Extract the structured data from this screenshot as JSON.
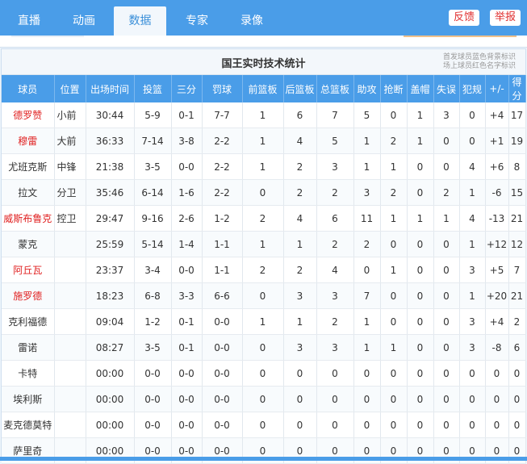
{
  "tabs": [
    {
      "label": "直播"
    },
    {
      "label": "动画"
    },
    {
      "label": "数据"
    },
    {
      "label": "专家"
    },
    {
      "label": "录像"
    }
  ],
  "buttons": {
    "feedback": "反馈",
    "report": "举报"
  },
  "panel": {
    "title": "国王实时技术统计",
    "note_line1": "首发球员蓝色背景标识",
    "note_line2": "场上球员红色名字标识"
  },
  "columns": [
    "球员",
    "位置",
    "出场时间",
    "投篮",
    "三分",
    "罚球",
    "前篮板",
    "后篮板",
    "总篮板",
    "助攻",
    "抢断",
    "盖帽",
    "失误",
    "犯规",
    "+/-",
    "得分"
  ],
  "colors": {
    "accent": "#4a9de8",
    "oncourt_name": "#e02020"
  },
  "rows": [
    {
      "name": "德罗赞",
      "pos": "小前",
      "min": "30:44",
      "fg": "5-9",
      "tp": "0-1",
      "ft": "7-7",
      "oreb": "1",
      "dreb": "6",
      "reb": "7",
      "ast": "5",
      "stl": "0",
      "blk": "1",
      "tov": "3",
      "pf": "0",
      "pm": "+4",
      "pts": "17",
      "oncourt": true
    },
    {
      "name": "穆雷",
      "pos": "大前",
      "min": "36:33",
      "fg": "7-14",
      "tp": "3-8",
      "ft": "2-2",
      "oreb": "1",
      "dreb": "4",
      "reb": "5",
      "ast": "1",
      "stl": "2",
      "blk": "1",
      "tov": "0",
      "pf": "0",
      "pm": "+1",
      "pts": "19",
      "oncourt": true
    },
    {
      "name": "尤班克斯",
      "pos": "中锋",
      "min": "21:38",
      "fg": "3-5",
      "tp": "0-0",
      "ft": "2-2",
      "oreb": "1",
      "dreb": "2",
      "reb": "3",
      "ast": "1",
      "stl": "1",
      "blk": "0",
      "tov": "0",
      "pf": "4",
      "pm": "+6",
      "pts": "8",
      "oncourt": false
    },
    {
      "name": "拉文",
      "pos": "分卫",
      "min": "35:46",
      "fg": "6-14",
      "tp": "1-6",
      "ft": "2-2",
      "oreb": "0",
      "dreb": "2",
      "reb": "2",
      "ast": "3",
      "stl": "2",
      "blk": "0",
      "tov": "2",
      "pf": "1",
      "pm": "-6",
      "pts": "15",
      "oncourt": false
    },
    {
      "name": "威斯布鲁克",
      "pos": "控卫",
      "min": "29:47",
      "fg": "9-16",
      "tp": "2-6",
      "ft": "1-2",
      "oreb": "2",
      "dreb": "4",
      "reb": "6",
      "ast": "11",
      "stl": "1",
      "blk": "1",
      "tov": "1",
      "pf": "4",
      "pm": "-13",
      "pts": "21",
      "oncourt": true
    },
    {
      "name": "蒙克",
      "pos": "",
      "min": "25:59",
      "fg": "5-14",
      "tp": "1-4",
      "ft": "1-1",
      "oreb": "1",
      "dreb": "1",
      "reb": "2",
      "ast": "2",
      "stl": "0",
      "blk": "0",
      "tov": "0",
      "pf": "1",
      "pm": "+12",
      "pts": "12",
      "oncourt": false
    },
    {
      "name": "阿丘瓦",
      "pos": "",
      "min": "23:37",
      "fg": "3-4",
      "tp": "0-0",
      "ft": "1-1",
      "oreb": "2",
      "dreb": "2",
      "reb": "4",
      "ast": "0",
      "stl": "1",
      "blk": "0",
      "tov": "0",
      "pf": "3",
      "pm": "+5",
      "pts": "7",
      "oncourt": true
    },
    {
      "name": "施罗德",
      "pos": "",
      "min": "18:23",
      "fg": "6-8",
      "tp": "3-3",
      "ft": "6-6",
      "oreb": "0",
      "dreb": "3",
      "reb": "3",
      "ast": "7",
      "stl": "0",
      "blk": "0",
      "tov": "0",
      "pf": "1",
      "pm": "+20",
      "pts": "21",
      "oncourt": true
    },
    {
      "name": "克利福德",
      "pos": "",
      "min": "09:04",
      "fg": "1-2",
      "tp": "0-1",
      "ft": "0-0",
      "oreb": "1",
      "dreb": "1",
      "reb": "2",
      "ast": "1",
      "stl": "0",
      "blk": "0",
      "tov": "0",
      "pf": "3",
      "pm": "+4",
      "pts": "2",
      "oncourt": false
    },
    {
      "name": "雷诺",
      "pos": "",
      "min": "08:27",
      "fg": "3-5",
      "tp": "0-1",
      "ft": "0-0",
      "oreb": "0",
      "dreb": "3",
      "reb": "3",
      "ast": "1",
      "stl": "1",
      "blk": "0",
      "tov": "0",
      "pf": "3",
      "pm": "-8",
      "pts": "6",
      "oncourt": false
    },
    {
      "name": "卡特",
      "pos": "",
      "min": "00:00",
      "fg": "0-0",
      "tp": "0-0",
      "ft": "0-0",
      "oreb": "0",
      "dreb": "0",
      "reb": "0",
      "ast": "0",
      "stl": "0",
      "blk": "0",
      "tov": "0",
      "pf": "0",
      "pm": "0",
      "pts": "0",
      "oncourt": false
    },
    {
      "name": "埃利斯",
      "pos": "",
      "min": "00:00",
      "fg": "0-0",
      "tp": "0-0",
      "ft": "0-0",
      "oreb": "0",
      "dreb": "0",
      "reb": "0",
      "ast": "0",
      "stl": "0",
      "blk": "0",
      "tov": "0",
      "pf": "0",
      "pm": "0",
      "pts": "0",
      "oncourt": false
    },
    {
      "name": "麦克德莫特",
      "pos": "",
      "min": "00:00",
      "fg": "0-0",
      "tp": "0-0",
      "ft": "0-0",
      "oreb": "0",
      "dreb": "0",
      "reb": "0",
      "ast": "0",
      "stl": "0",
      "blk": "0",
      "tov": "0",
      "pf": "0",
      "pm": "0",
      "pts": "0",
      "oncourt": false
    },
    {
      "name": "萨里奇",
      "pos": "",
      "min": "00:00",
      "fg": "0-0",
      "tp": "0-0",
      "ft": "0-0",
      "oreb": "0",
      "dreb": "0",
      "reb": "0",
      "ast": "0",
      "stl": "0",
      "blk": "0",
      "tov": "0",
      "pf": "0",
      "pm": "0",
      "pts": "0",
      "oncourt": false
    }
  ]
}
